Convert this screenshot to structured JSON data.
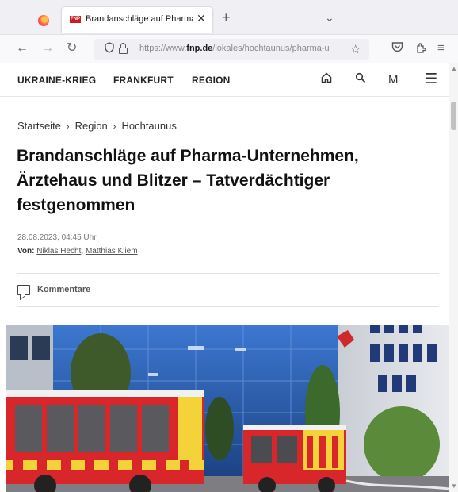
{
  "browser": {
    "tab": {
      "favicon_text": "FNP",
      "title": "Brandanschläge auf Pharma-Un",
      "close_glyph": "✕"
    },
    "new_tab_glyph": "+",
    "tab_list_glyph": "⌄",
    "nav": {
      "back_glyph": "←",
      "forward_glyph": "→",
      "reload_glyph": "↻"
    },
    "url": {
      "prefix": "https://www.",
      "domain": "fnp.de",
      "path": "/lokales/hochtaunus/pharma-u"
    },
    "toolbar_icons": [
      "firefox-icon",
      "tracking-shield-icon",
      "lock-icon",
      "bookmark-star-icon",
      "pocket-icon",
      "extensions-icon",
      "menu-icon"
    ]
  },
  "site": {
    "nav": [
      "UKRAINE-KRIEG",
      "FRANKFURT",
      "REGION"
    ],
    "icons": {
      "home": "⌂",
      "search": "⚲",
      "account": "M",
      "menu": "☰"
    }
  },
  "article": {
    "breadcrumb": [
      "Startseite",
      "Region",
      "Hochtaunus"
    ],
    "breadcrumb_sep": "›",
    "headline": "Brandanschläge auf Pharma-Unternehmen, Ärztehaus und Blitzer – Tatverdächtiger festgenommen",
    "date": "28.08.2023, 04:45 Uhr",
    "authors_label": "Von:",
    "authors": [
      "Niklas Hecht",
      "Matthias Kliem"
    ],
    "authors_separator": ", ",
    "comments_label": "Kommentare"
  },
  "colors": {
    "brand_red": "#c91b22",
    "fire_truck_red": "#d8262b",
    "sky_blue": "#2a5fb8"
  }
}
